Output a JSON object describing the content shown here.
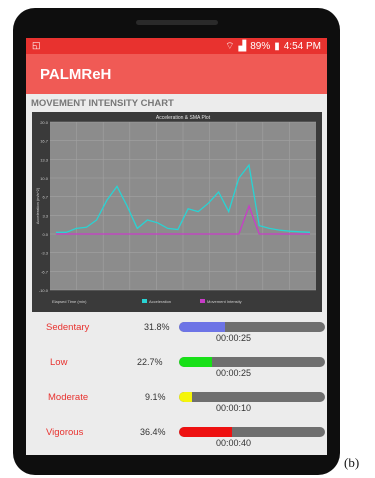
{
  "status": {
    "time": "4:54 PM",
    "battery": "89%"
  },
  "app": {
    "title": "PALMReH"
  },
  "section": {
    "title": "MOVEMENT INTENSITY CHART"
  },
  "chart_data": {
    "type": "line",
    "title": "Acceleration & SMA Plot",
    "ylabel": "Acceleration (m/s^2)",
    "xlabel": "Elapsed Time (min)",
    "ylim": [
      0,
      20
    ],
    "yticks": [
      "20.0",
      "16.7",
      "13.3",
      "10.0",
      "6.7",
      "3.3",
      "0.0",
      "-3.3",
      "-6.7",
      "-10.0"
    ],
    "series": [
      {
        "name": "Acceleration",
        "color": "#29d3d3",
        "values": [
          0.3,
          0.3,
          1.0,
          1.2,
          2.5,
          6.0,
          8.5,
          5.0,
          1.0,
          2.5,
          2.0,
          1.0,
          0.8,
          4.5,
          4.0,
          5.5,
          7.5,
          4.0,
          10.0,
          12.3,
          1.5,
          1.0,
          0.7,
          0.5,
          0.4,
          0.3
        ]
      },
      {
        "name": "Movement Intensity",
        "color": "#c83cc8",
        "values": [
          0,
          0,
          0,
          0,
          0,
          0,
          0,
          0,
          0,
          0,
          0,
          0,
          0,
          0,
          0,
          0,
          0,
          0,
          0,
          5.0,
          0,
          0,
          0,
          0,
          0,
          0
        ]
      }
    ]
  },
  "intensity": [
    {
      "label": "Sedentary",
      "percent": "31.8%",
      "fraction": 0.318,
      "time": "00:00:25",
      "color": "#6d74e6"
    },
    {
      "label": "Low",
      "percent": "22.7%",
      "fraction": 0.227,
      "time": "00:00:25",
      "color": "#18e018"
    },
    {
      "label": "Moderate",
      "percent": "9.1%",
      "fraction": 0.091,
      "time": "00:00:10",
      "color": "#f5f50a"
    },
    {
      "label": "Vigorous",
      "percent": "36.4%",
      "fraction": 0.364,
      "time": "00:00:40",
      "color": "#ee1111"
    }
  ],
  "figure_label": "(b)"
}
